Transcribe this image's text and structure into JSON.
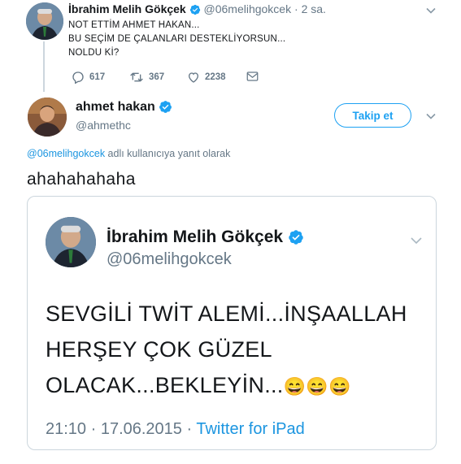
{
  "parent_tweet": {
    "name": "İbrahim Melih Gökçek",
    "handle": "@06melihgokcek",
    "separator": "·",
    "time": "2 sa.",
    "lines": [
      "NOT ETTİM AHMET HAKAN...",
      "BU SEÇİM DE ÇALANLARI DESTEKLİYORSUN...",
      "NOLDU Kİ?"
    ],
    "actions": {
      "reply_count": "617",
      "retweet_count": "367",
      "like_count": "2238"
    }
  },
  "main_tweet": {
    "name": "ahmet hakan",
    "handle": "@ahmethc",
    "follow_label": "Takip et",
    "reply_mention": "@06melihgokcek",
    "reply_suffix": " adlı kullanıcıya yanıt olarak",
    "text": "ahahahahaha"
  },
  "embedded_image": {
    "name": "İbrahim Melih Gökçek",
    "handle": "@06melihgokcek",
    "lines": [
      "SEVGİLİ TWİT ALEMİ...İNŞAALLAH",
      "HERŞEY ÇOK GÜZEL",
      "OLACAK...BEKLEYİN..."
    ],
    "emoji": "😄😄😄",
    "timestamp": "21:10 · 17.06.2015 · ",
    "source": "Twitter for iPad"
  },
  "colors": {
    "accent": "#1da1f2",
    "link": "#1b95e0",
    "muted": "#657786",
    "border": "#ccd6dd",
    "verified": "#1da1f2"
  },
  "icons": [
    "verified-badge-icon",
    "chevron-down-icon",
    "reply-icon",
    "retweet-icon",
    "like-icon",
    "dm-icon"
  ]
}
